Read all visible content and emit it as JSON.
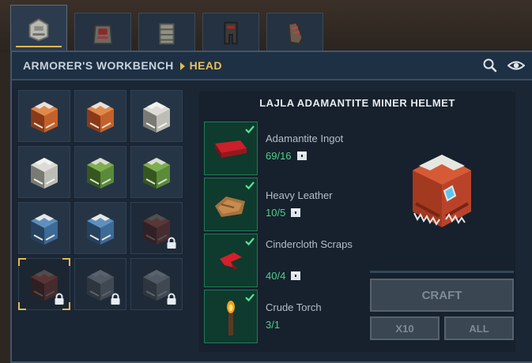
{
  "tabs": [
    {
      "name": "head",
      "active": true
    },
    {
      "name": "chest",
      "active": false
    },
    {
      "name": "hands",
      "active": false
    },
    {
      "name": "legs",
      "active": false
    },
    {
      "name": "feet",
      "active": false
    }
  ],
  "header": {
    "workbench": "ARMORER'S WORKBENCH",
    "category": "HEAD",
    "icons": [
      "search-icon",
      "eye-icon"
    ]
  },
  "recipe": {
    "title": "LAJLA ADAMANTITE MINER HELMET",
    "ingredients": [
      {
        "name": "Adamantite Ingot",
        "qty": "69/16",
        "icon": "adamantite-ingot-icon",
        "satisfied": true,
        "storage": true
      },
      {
        "name": "Heavy Leather",
        "qty": "10/5",
        "icon": "heavy-leather-icon",
        "satisfied": true,
        "storage": true
      },
      {
        "name": "Cindercloth Scraps",
        "qty": "40/4",
        "icon": "cindercloth-scraps-icon",
        "satisfied": true,
        "storage": true
      },
      {
        "name": "Crude Torch",
        "qty": "3/1",
        "icon": "crude-torch-icon",
        "satisfied": true,
        "storage": false
      }
    ]
  },
  "actions": {
    "craft": "CRAFT",
    "x10": "X10",
    "all": "ALL"
  },
  "grid": [
    {
      "variant": "copper",
      "locked": false
    },
    {
      "variant": "copper",
      "locked": false
    },
    {
      "variant": "iron",
      "locked": false
    },
    {
      "variant": "iron",
      "locked": false
    },
    {
      "variant": "green",
      "locked": false
    },
    {
      "variant": "green",
      "locked": false
    },
    {
      "variant": "blue",
      "locked": false
    },
    {
      "variant": "blue",
      "locked": false
    },
    {
      "variant": "red",
      "locked": true
    },
    {
      "variant": "red",
      "locked": true,
      "selected": true
    },
    {
      "variant": "grey",
      "locked": true
    },
    {
      "variant": "grey",
      "locked": true
    }
  ],
  "colors": {
    "accent": "#e3b84f",
    "satisfied": "#4fd08a",
    "panel": "#1a2634"
  }
}
